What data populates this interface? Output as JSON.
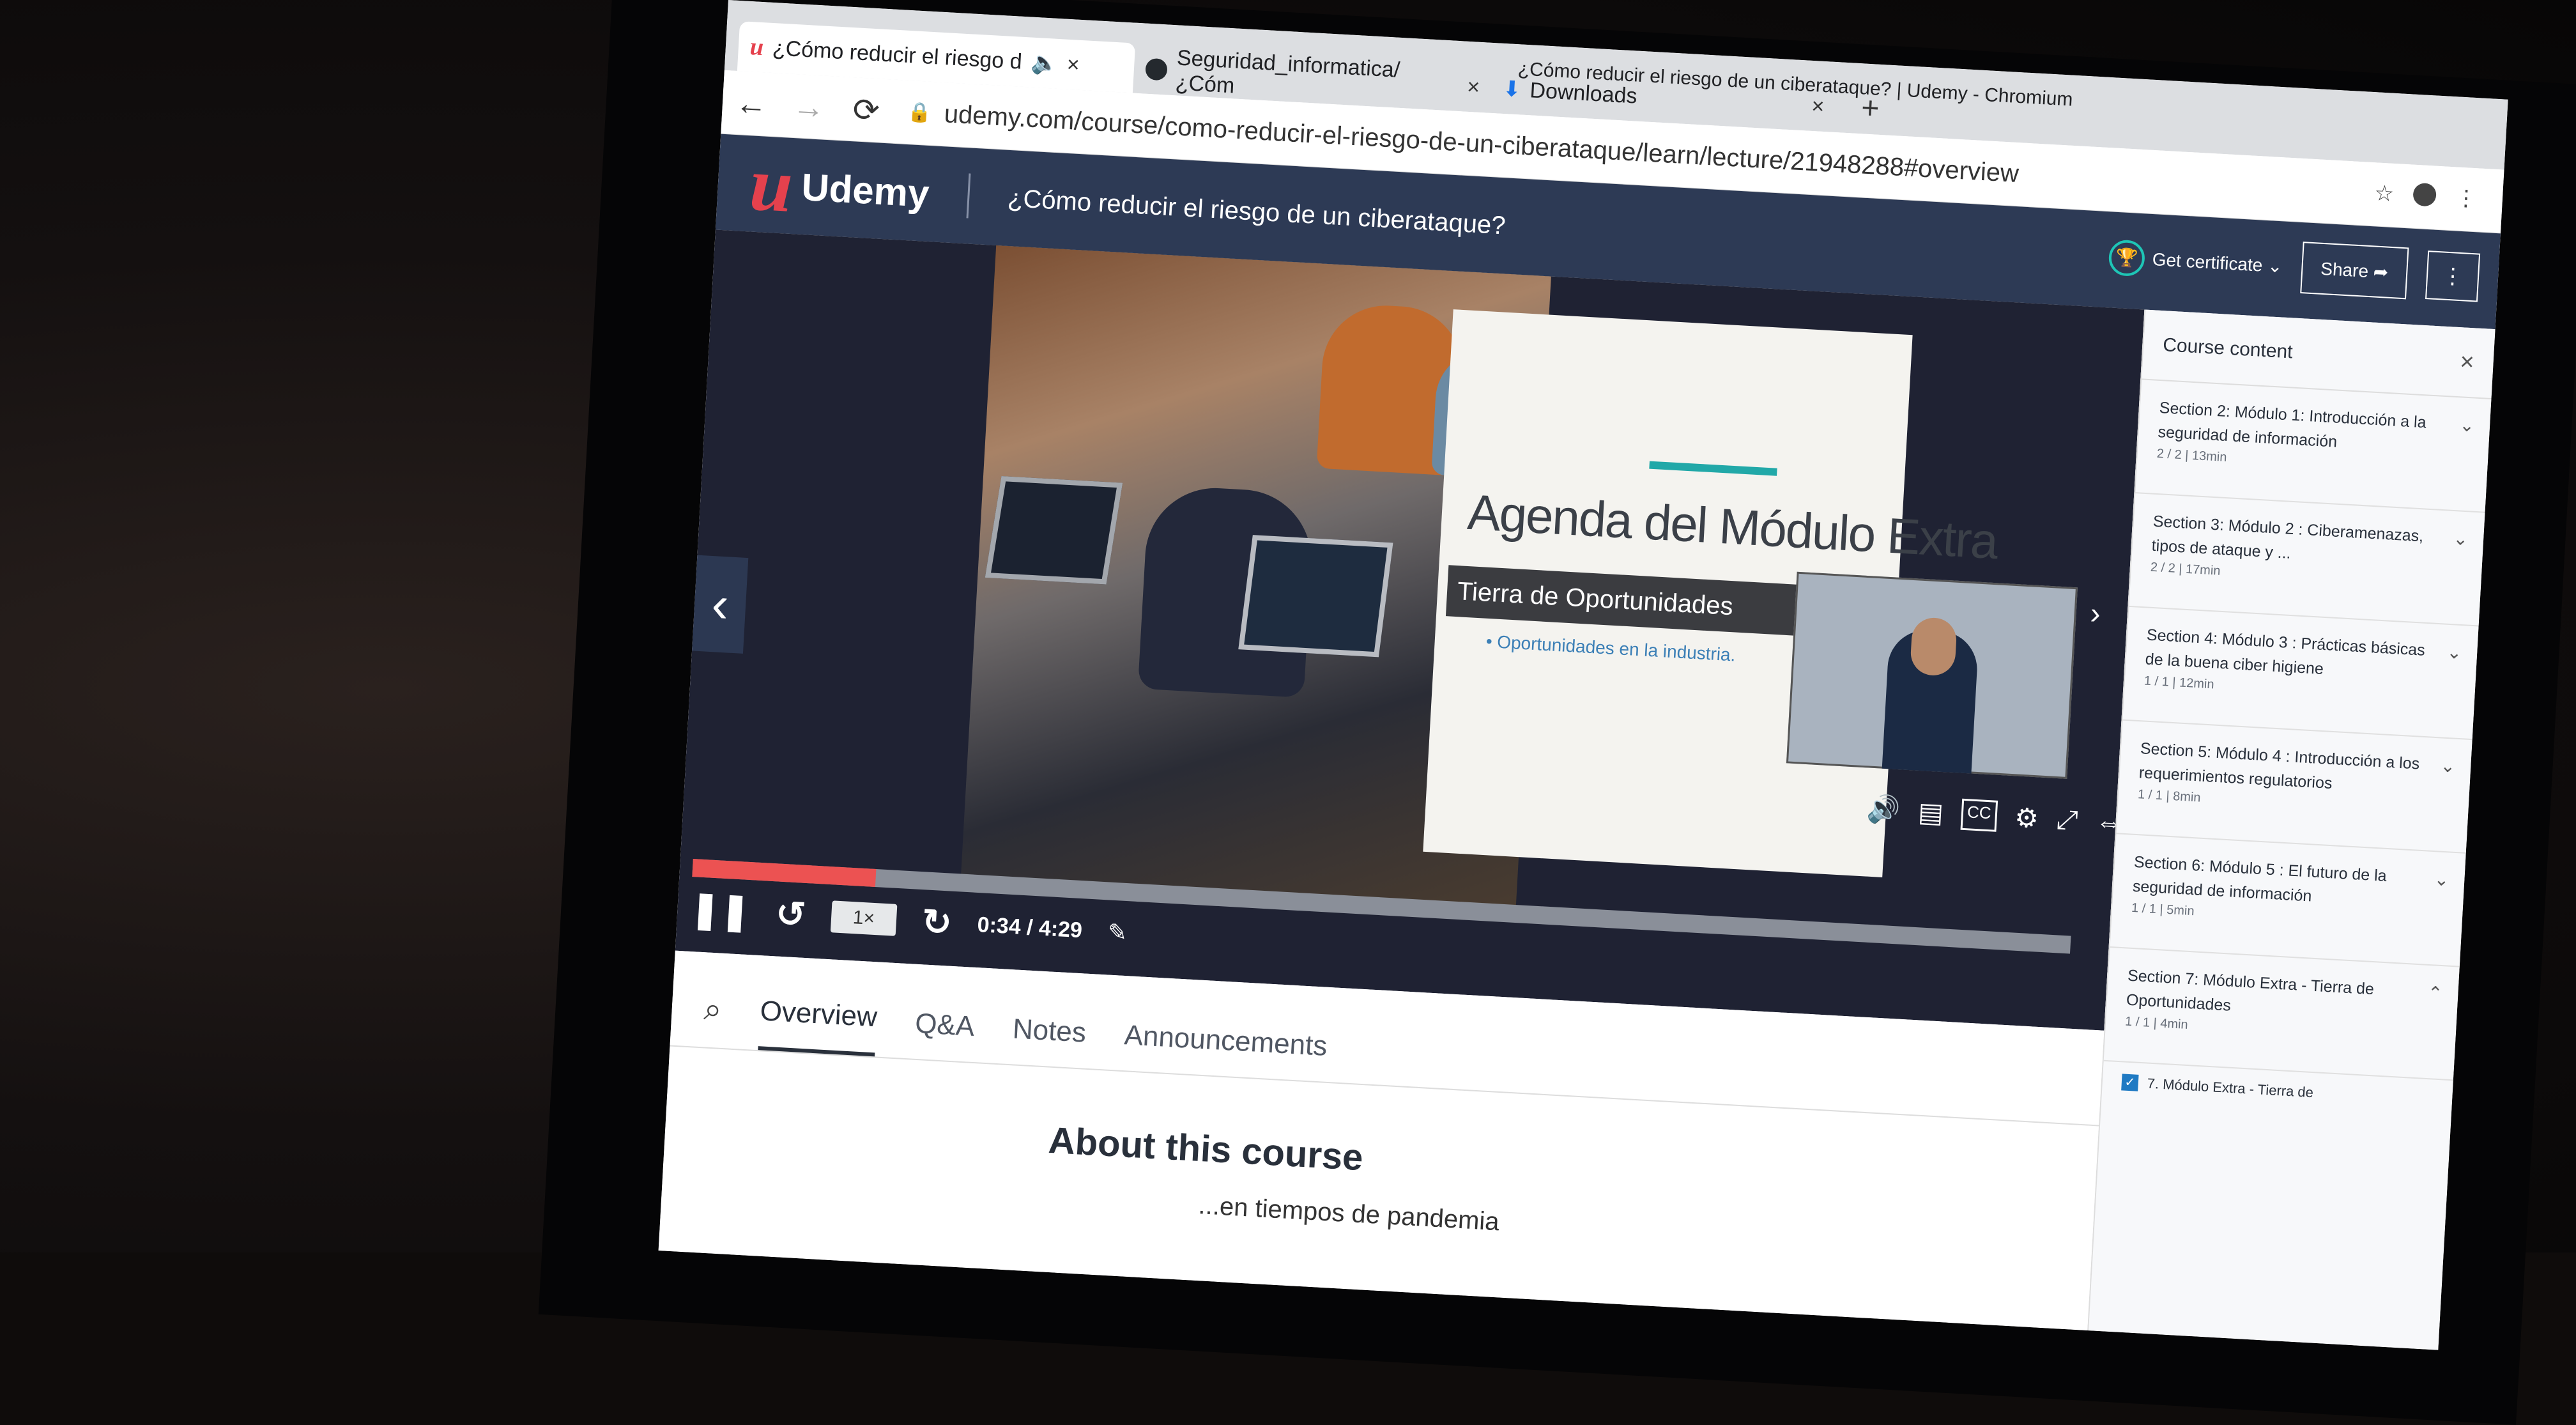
{
  "browser": {
    "window_title": "¿Cómo reducir el riesgo de un ciberataque? | Udemy - Chromium",
    "tabs": [
      {
        "label": "¿Cómo reducir el riesgo d",
        "icon": "udemy-icon",
        "audio": "speaker-icon",
        "close": "×"
      },
      {
        "label": "Seguridad_informatica/¿Cóm",
        "icon": "github-icon",
        "close": "×"
      },
      {
        "label": "Downloads",
        "icon": "download-icon",
        "close": "×"
      }
    ],
    "new_tab": "+",
    "back": "←",
    "forward": "→",
    "reload": "⟳",
    "url": "udemy.com/course/como-reducir-el-riesgo-de-un-ciberataque/learn/lecture/21948288#overview",
    "star": "☆",
    "menu": "⋮"
  },
  "header": {
    "logo_mark": "u",
    "logo_text": "Udemy",
    "course_title": "¿Cómo reducir el riesgo de un ciberataque?",
    "certificate_label": "Get certificate ⌄",
    "share_label": "Share ➦",
    "more": "⋮"
  },
  "video": {
    "slide_title": "Agenda del Módulo Extra",
    "slide_subtitle": "Tierra de Oportunidades",
    "slide_bullet": "Oportunidades en la industria.",
    "progress_fraction": 0.133,
    "speed": "1×",
    "time": "0:34 / 4:29",
    "prev": "‹",
    "next": "›",
    "pause": "❚❚",
    "rewind": "↺",
    "forward": "↻",
    "cc": "CC"
  },
  "sidebar": {
    "title": "Course content",
    "close": "×",
    "sections": [
      {
        "title": "Section 2: Módulo 1: Introducción a la seguridad de información",
        "meta": "2 / 2 | 13min",
        "chev": "⌄"
      },
      {
        "title": "Section 3: Módulo 2 : Ciberamenazas, tipos de ataque y ...",
        "meta": "2 / 2 | 17min",
        "chev": "⌄"
      },
      {
        "title": "Section 4: Módulo 3 : Prácticas básicas de la buena ciber higiene",
        "meta": "1 / 1 | 12min",
        "chev": "⌄"
      },
      {
        "title": "Section 5: Módulo 4 : Introducción a los requerimientos regulatorios",
        "meta": "1 / 1 | 8min",
        "chev": "⌄"
      },
      {
        "title": "Section 6: Módulo 5 : El futuro de la seguridad de información",
        "meta": "1 / 1 | 5min",
        "chev": "⌄"
      },
      {
        "title": "Section 7: Módulo Extra - Tierra de Oportunidades",
        "meta": "1 / 1 | 4min",
        "chev": "⌃"
      }
    ],
    "lecture": "7. Módulo Extra - Tierra de"
  },
  "content_tabs": [
    "Overview",
    "Q&A",
    "Notes",
    "Announcements"
  ],
  "about": {
    "heading": "About this course",
    "sub": "...en tiempos de pandemia"
  },
  "colors": {
    "udemy_red": "#e5414d",
    "header_navy": "#2d3a55",
    "progress_red": "#ec5252",
    "accent_teal": "#1ec6b6"
  }
}
